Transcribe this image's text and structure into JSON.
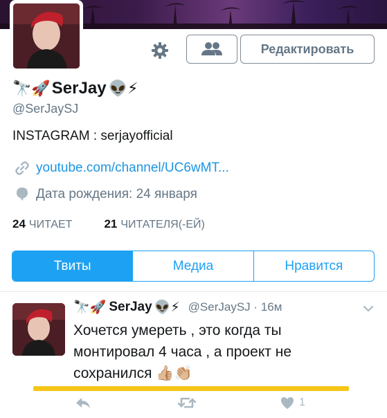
{
  "profile": {
    "name_prefix_emoji": "🔭🚀",
    "name": "SerJay",
    "name_suffix_emoji": "👽⚡",
    "handle": "@SerJaySJ",
    "bio": "INSTAGRAM : serjayofficial",
    "link": "youtube.com/channel/UC6wMT...",
    "birthday": "Дата рождения: 24 января",
    "following_count": "24",
    "following_label": "ЧИТАЕТ",
    "followers_count": "21",
    "followers_label": "ЧИТАТЕЛЯ(-ЕЙ)"
  },
  "header": {
    "edit_label": "Редактировать"
  },
  "tabs": [
    {
      "label": "Твиты",
      "active": true
    },
    {
      "label": "Медиа",
      "active": false
    },
    {
      "label": "Нравится",
      "active": false
    }
  ],
  "tweet": {
    "name_prefix_emoji": "🔭🚀",
    "name": "SerJay",
    "name_suffix_emoji": "👽⚡",
    "handle_time": "@SerJaySJ · 16м",
    "text": "Хочется умереть , это когда ты монтировал 4 часа , а проект не сохранился",
    "text_emoji": "👍🏼👏🏼",
    "like_count": "1"
  },
  "colors": {
    "accent": "#1da1f2",
    "link": "#1b95e0",
    "muted": "#657786",
    "highlight": "#f5c518"
  },
  "icons": [
    "gear-icon",
    "people-icon",
    "link-icon",
    "balloon-icon",
    "chevron-down-icon",
    "reply-icon",
    "retweet-icon",
    "heart-icon"
  ]
}
